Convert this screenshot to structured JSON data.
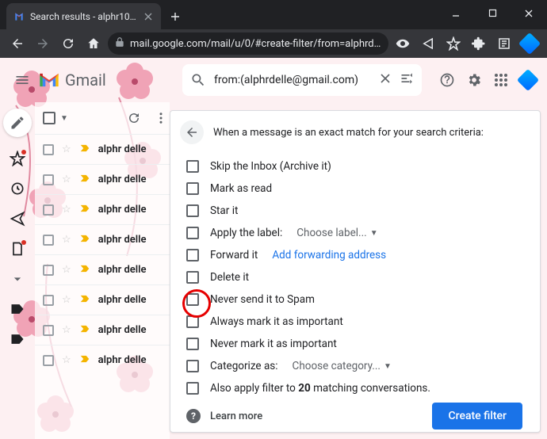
{
  "browser": {
    "tab_title": "Search results - alphr101@gmail...",
    "url": "mail.google.com/mail/u/0/#create-filter/from=alphrdelle%40gma..."
  },
  "header": {
    "product": "Gmail",
    "search_value": "from:(alphrdelle@gmail.com)"
  },
  "mail_list": {
    "sender": "alphr delle",
    "rows": 8
  },
  "filter_panel": {
    "title": "When a message is an exact match for your search criteria:",
    "options": {
      "skip_inbox": "Skip the Inbox (Archive it)",
      "mark_read": "Mark as read",
      "star_it": "Star it",
      "apply_label": "Apply the label:",
      "choose_label": "Choose label...",
      "forward_it": "Forward it",
      "add_forward": "Add forwarding address",
      "delete_it": "Delete it",
      "never_spam": "Never send it to Spam",
      "always_important": "Always mark it as important",
      "never_important": "Never mark it as important",
      "categorize_as": "Categorize as:",
      "choose_category": "Choose category...",
      "also_apply_pre": "Also apply filter to ",
      "also_apply_count": "20",
      "also_apply_post": " matching conversations."
    },
    "learn_more": "Learn more",
    "create_filter": "Create filter"
  }
}
